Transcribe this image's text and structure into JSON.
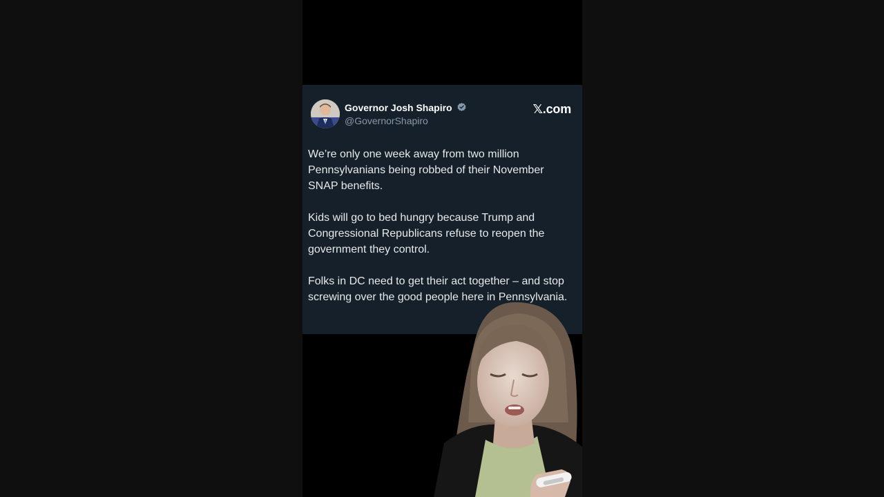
{
  "tweet": {
    "author_name": "Governor Josh Shapiro",
    "author_handle": "@GovernorShapiro",
    "brand": "𝕏.com",
    "paragraphs": [
      "We’re only one week away from two million Pennsylvanians being robbed of their November SNAP benefits.",
      "Kids will go to bed hungry because Trump and Congressional Republicans refuse to reopen the government they control.",
      "Folks in DC need to get their act together – and stop screwing over the good people here in Pennsylvania."
    ],
    "verified_icon": "verified-badge-icon",
    "colors": {
      "card_background": "#15202b",
      "text": "#e7e9ea",
      "handle": "#8b98a5"
    }
  }
}
